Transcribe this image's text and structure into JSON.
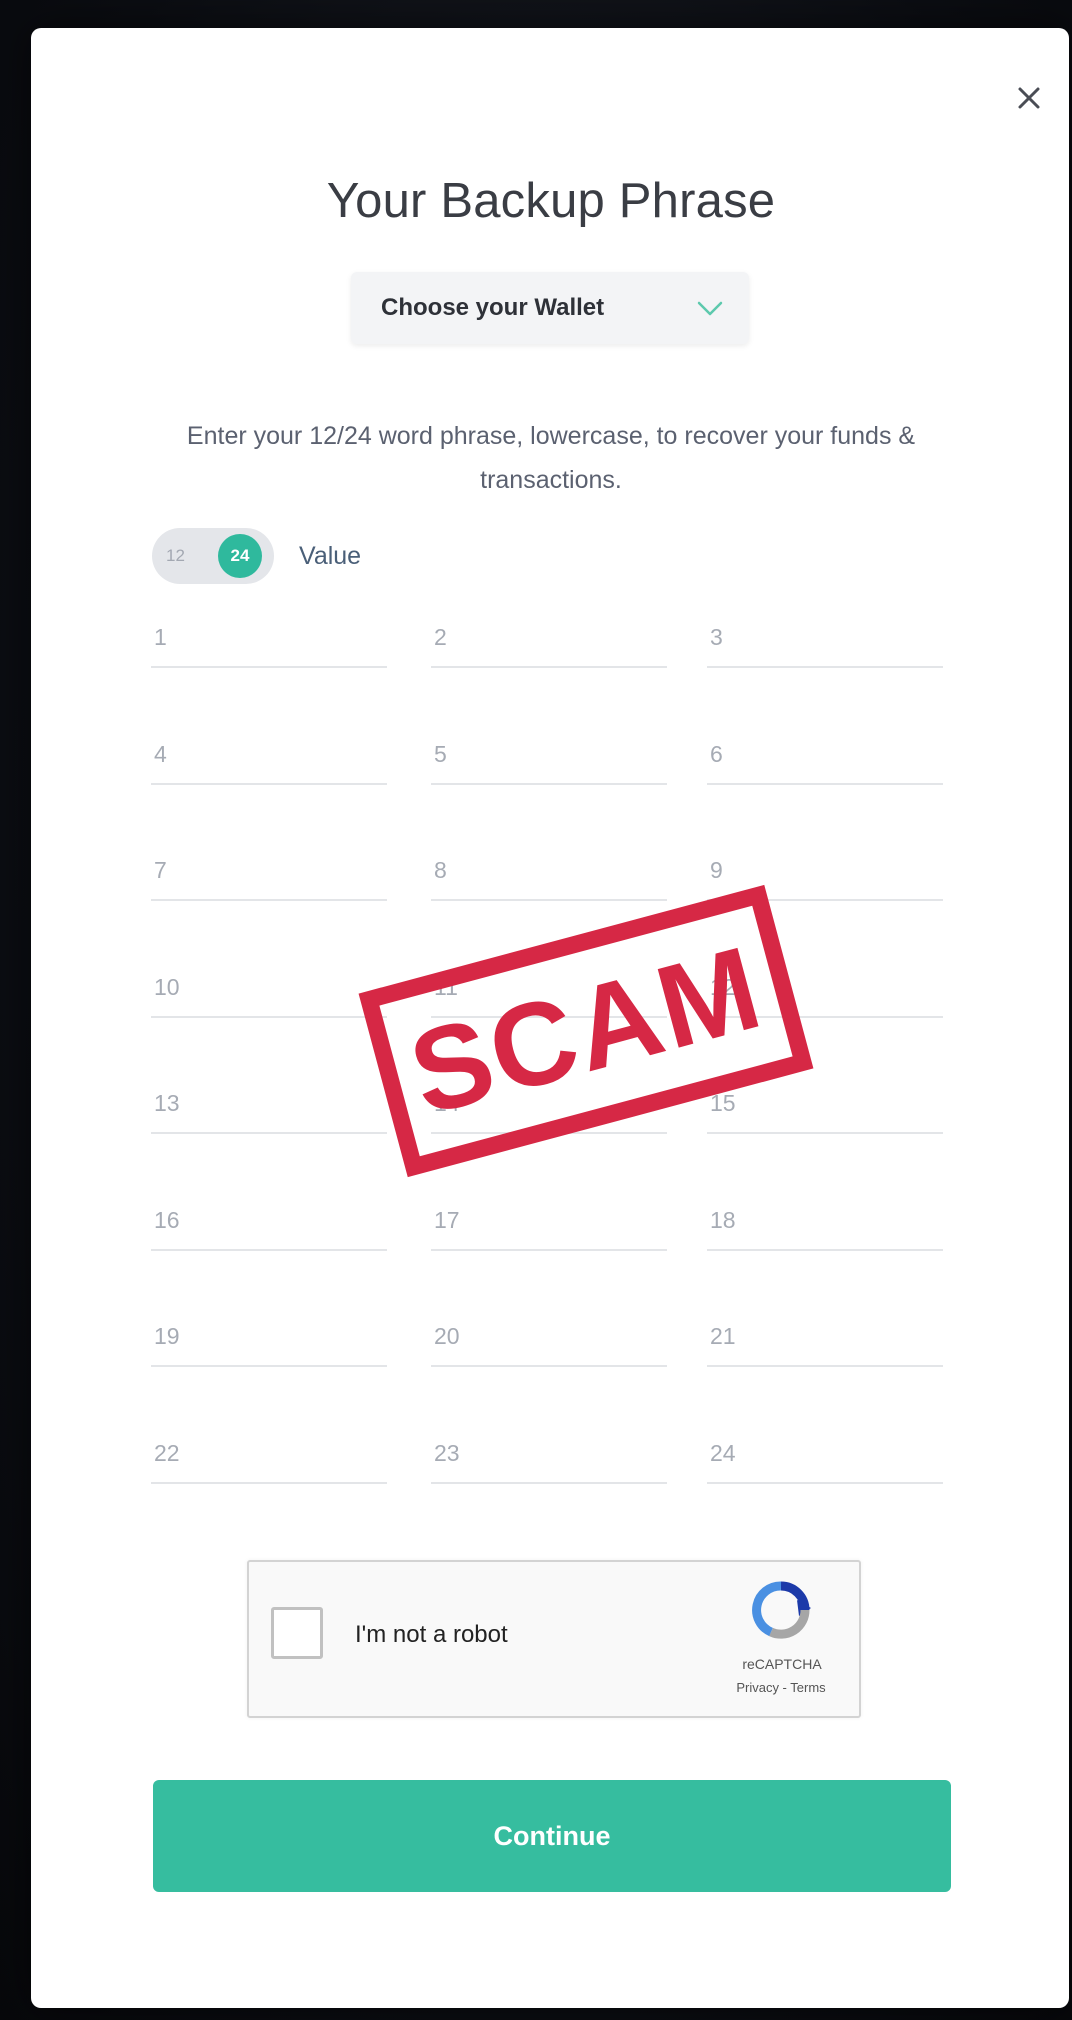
{
  "modal": {
    "title": "Your Backup Phrase",
    "close_icon": "close-icon",
    "wallet_select": {
      "selected": "Choose your Wallet",
      "icon": "chevron-down-icon"
    },
    "instructions": "Enter your 12/24 word phrase, lowercase, to recover your funds & transactions.",
    "toggle": {
      "option_12": "12",
      "option_24": "24",
      "selected": "24",
      "label": "Value"
    },
    "phrase_fields": [
      "1",
      "2",
      "3",
      "4",
      "5",
      "6",
      "7",
      "8",
      "9",
      "10",
      "11",
      "12",
      "13",
      "14",
      "15",
      "16",
      "17",
      "18",
      "19",
      "20",
      "21",
      "22",
      "23",
      "24"
    ],
    "captcha": {
      "label": "I'm not a robot",
      "brand": "reCAPTCHA",
      "links": "Privacy - Terms",
      "icon": "recaptcha-logo-icon"
    },
    "continue_label": "Continue"
  },
  "stamp": {
    "text": "SCAM"
  },
  "colors": {
    "accent": "#36bd9f",
    "stamp": "#d62845"
  }
}
